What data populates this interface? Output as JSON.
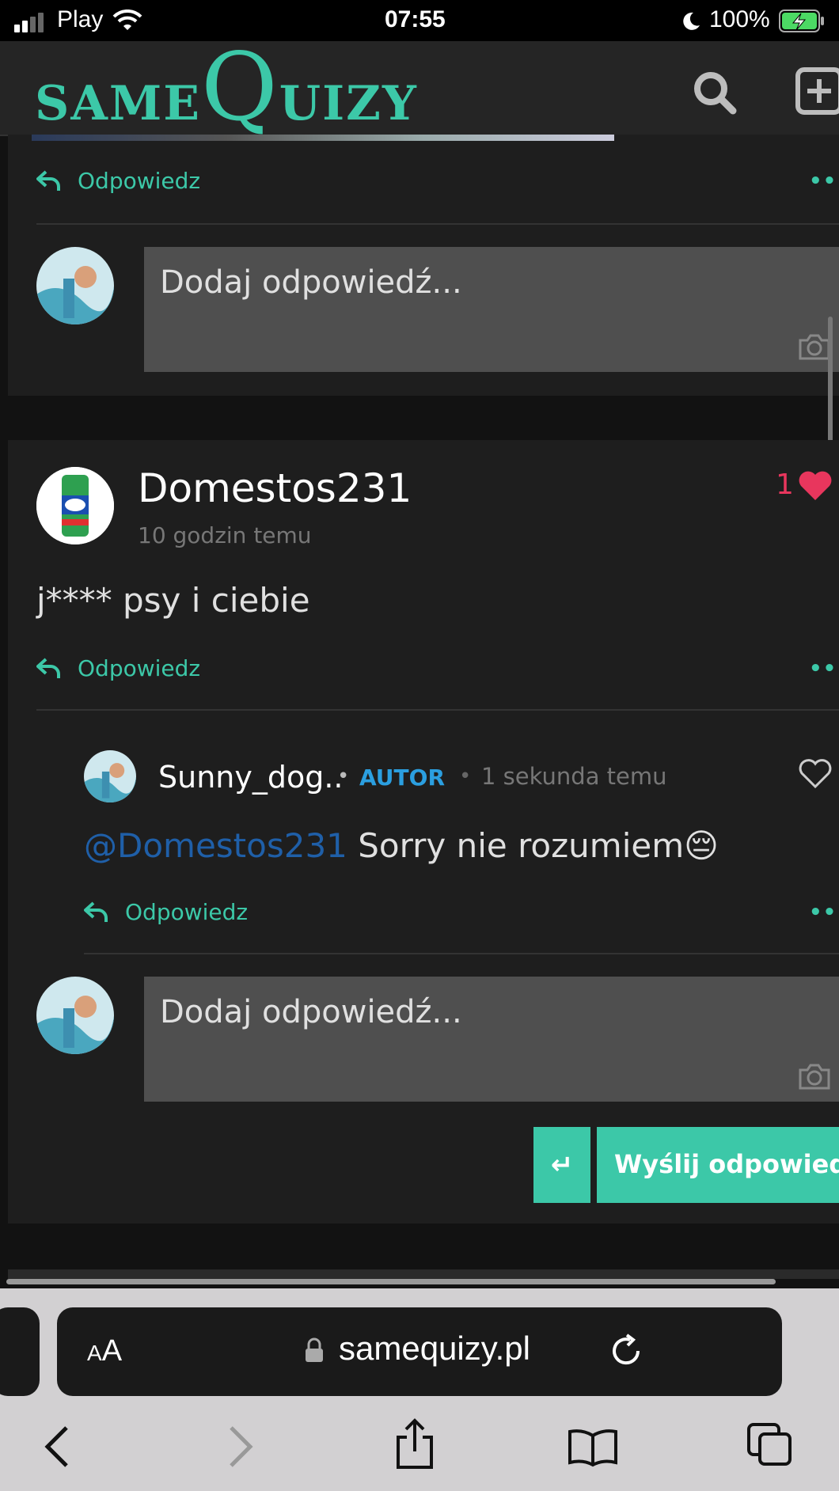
{
  "status_bar": {
    "carrier": "Play",
    "time": "07:55",
    "battery": "100%"
  },
  "site": {
    "logo_same": "SAME",
    "logo_q": "Q",
    "logo_uizy": "UIZY",
    "accent_color": "#3cc8a8"
  },
  "top_thread": {
    "reply_label": "Odpowiedz",
    "input_placeholder": "Dodaj odpowiedź..."
  },
  "comment": {
    "author": "Domestos231",
    "time": "10 godzin temu",
    "likes": "1",
    "text": "j**** psy i ciebie",
    "reply_label": "Odpowiedz",
    "reply": {
      "author": "Sunny_dog..",
      "badge": "AUTOR",
      "time": "1 sekunda temu",
      "mention": "@Domestos231",
      "text": "Sorry nie rozumiem😔",
      "reply_label": "Odpowiedz"
    },
    "input_placeholder": "Dodaj odpowiedź...",
    "enter_icon": "↵",
    "send_label": "Wyślij odpowiedź"
  },
  "browser": {
    "text_size_label": "AA",
    "url": "samequizy.pl"
  }
}
